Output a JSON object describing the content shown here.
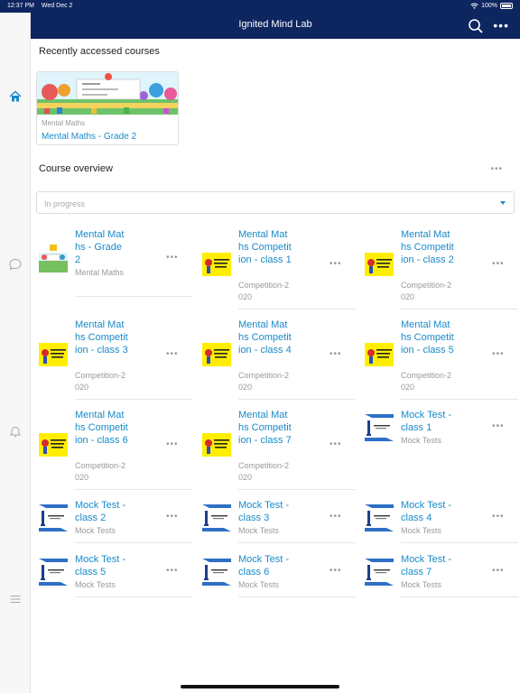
{
  "status": {
    "time": "12:37 PM",
    "date": "Wed Dec 2",
    "battery": "100%"
  },
  "app": {
    "title": "Ignited Mind Lab"
  },
  "icons": {
    "home": "home-icon",
    "chat": "chat-bubble-icon",
    "bell": "bell-icon",
    "menu": "hamburger-menu-icon",
    "search": "search-icon",
    "more": "more-horizontal-icon"
  },
  "recent": {
    "heading": "Recently accessed courses",
    "card": {
      "category": "Mental Maths",
      "name": "Mental Maths - Grade 2"
    }
  },
  "overview": {
    "heading": "Course overview",
    "filter_placeholder": "In progress",
    "more": "•••"
  },
  "accent": "#1a8ac8",
  "header_color": "#0d2660",
  "courses": [
    {
      "name": "Mental Maths - Grade 2",
      "category": "Mental Maths",
      "image": "grade"
    },
    {
      "name": "Mental Maths Competition - class 1",
      "category": "Competition-2020",
      "image": "competition"
    },
    {
      "name": "Mental Maths Competition - class 2",
      "category": "Competition-2020",
      "image": "competition"
    },
    {
      "name": "Mental Maths Competition - class 3",
      "category": "Competition-2020",
      "image": "competition"
    },
    {
      "name": "Mental Maths Competition - class 4",
      "category": "Competition-2020",
      "image": "competition"
    },
    {
      "name": "Mental Maths Competition - class 5",
      "category": "Competition-2020",
      "image": "competition"
    },
    {
      "name": "Mental Maths Competition - class 6",
      "category": "Competition-2020",
      "image": "competition"
    },
    {
      "name": "Mental Maths Competition - class 7",
      "category": "Competition-2020",
      "image": "competition"
    },
    {
      "name": "Mock Test - class 1",
      "category": "Mock Tests",
      "image": "mock"
    },
    {
      "name": "Mock Test - class 2",
      "category": "Mock Tests",
      "image": "mock"
    },
    {
      "name": "Mock Test - class 3",
      "category": "Mock Tests",
      "image": "mock"
    },
    {
      "name": "Mock Test - class 4",
      "category": "Mock Tests",
      "image": "mock"
    },
    {
      "name": "Mock Test - class 5",
      "category": "Mock Tests",
      "image": "mock"
    },
    {
      "name": "Mock Test - class 6",
      "category": "Mock Tests",
      "image": "mock"
    },
    {
      "name": "Mock Test - class 7",
      "category": "Mock Tests",
      "image": "mock"
    }
  ]
}
